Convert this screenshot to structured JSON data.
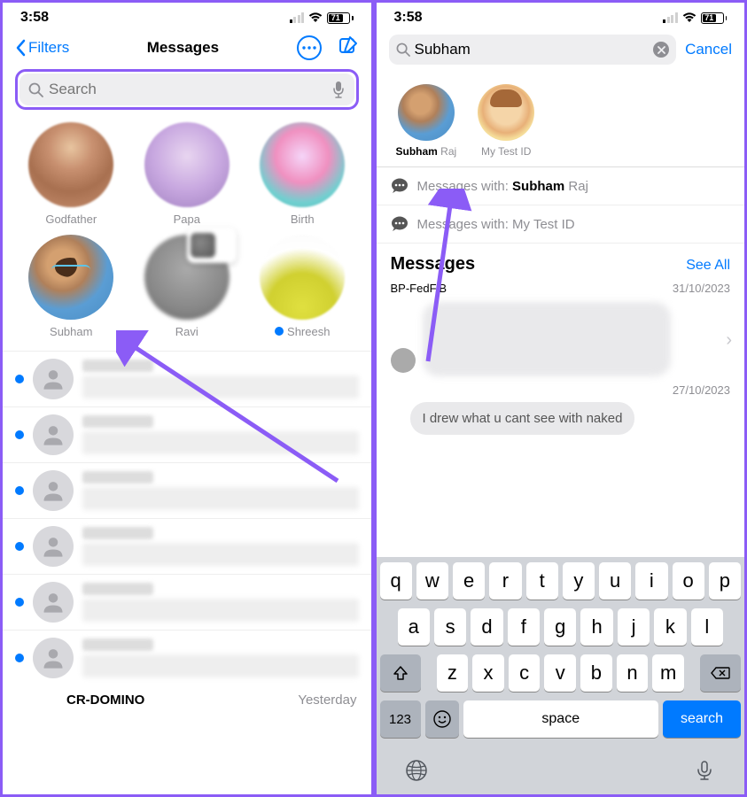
{
  "status": {
    "time": "3:58",
    "battery": "71"
  },
  "left": {
    "filters": "Filters",
    "title": "Messages",
    "search_placeholder": "Search",
    "pins": [
      {
        "name": "Godfather"
      },
      {
        "name": "Papa"
      },
      {
        "name": "Birth"
      },
      {
        "name": "Subham"
      },
      {
        "name": "Ravi"
      },
      {
        "name": "Shreesh",
        "unread": true
      }
    ],
    "last_visible_sender": "CR-DOMINO",
    "last_visible_time": "Yesterday"
  },
  "right": {
    "query": "Subham",
    "cancel": "Cancel",
    "contacts": [
      {
        "match": "Subham",
        "rest": " Raj"
      },
      {
        "match": "",
        "rest": "My Test ID"
      }
    ],
    "with_prefix": "Messages with: ",
    "with_links": [
      {
        "match": "Subham",
        "rest": " Raj"
      },
      {
        "match": "",
        "rest": "My Test ID"
      }
    ],
    "section_title": "Messages",
    "see_all": "See All",
    "results": [
      {
        "sender": "BP-FedFiB",
        "date": "31/10/2023"
      },
      {
        "date": "27/10/2023",
        "preview": "I drew what u cant see with naked"
      }
    ]
  },
  "keyboard": {
    "rows": [
      [
        "q",
        "w",
        "e",
        "r",
        "t",
        "y",
        "u",
        "i",
        "o",
        "p"
      ],
      [
        "a",
        "s",
        "d",
        "f",
        "g",
        "h",
        "j",
        "k",
        "l"
      ],
      [
        "z",
        "x",
        "c",
        "v",
        "b",
        "n",
        "m"
      ]
    ],
    "k123": "123",
    "space": "space",
    "search": "search"
  }
}
